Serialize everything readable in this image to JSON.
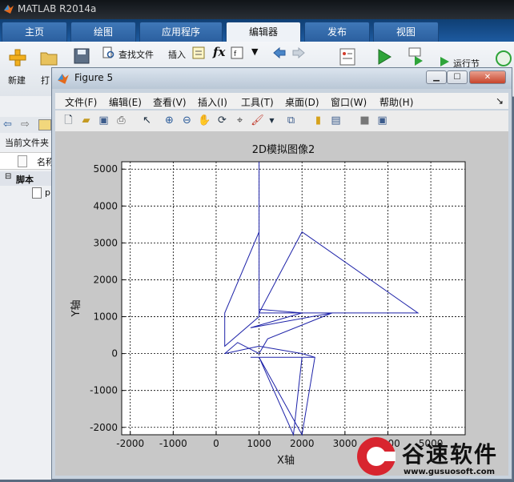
{
  "window": {
    "title": "MATLAB R2014a"
  },
  "tabs": [
    "主页",
    "绘图",
    "应用程序",
    "编辑器",
    "发布",
    "视图"
  ],
  "active_tab": "编辑器",
  "ribbon": {
    "new": "新建",
    "open_short": "打",
    "find_files": "查找文件",
    "insert": "插入",
    "fx": "fx",
    "run_advance": "运行节"
  },
  "left_panel": {
    "current_folder": "当前文件夹",
    "name_col": "名称",
    "script_group": "脚本",
    "file_initial": "p"
  },
  "figure": {
    "title": "Figure 5",
    "menu": [
      "文件(F)",
      "编辑(E)",
      "查看(V)",
      "插入(I)",
      "工具(T)",
      "桌面(D)",
      "窗口(W)",
      "帮助(H)"
    ]
  },
  "chart_data": {
    "type": "line",
    "title": "2D模拟图像2",
    "xlabel": "X轴",
    "ylabel": "Y轴",
    "xlim": [
      -2200,
      5800
    ],
    "ylim": [
      -2200,
      5200
    ],
    "xticks": [
      -2000,
      -1000,
      0,
      1000,
      2000,
      3000,
      4000,
      5000
    ],
    "xtick_labels": [
      "-2000",
      "-1000",
      "0",
      "1000",
      "2000",
      "3000",
      "4000",
      "5000"
    ],
    "yticks": [
      -2000,
      -1000,
      0,
      1000,
      2000,
      3000,
      4000,
      5000
    ],
    "ytick_labels": [
      "-2000",
      "-1000",
      "0",
      "1000",
      "2000",
      "3000",
      "4000",
      "5000"
    ],
    "grid": true,
    "line_color": "#1d22a8",
    "series": [
      {
        "x": [
          1000,
          1000,
          200,
          200,
          1000,
          1000,
          1000,
          1000,
          2000,
          4700,
          1000,
          1000,
          2000,
          800,
          2700,
          1200,
          1000,
          500,
          200,
          1000,
          2000,
          2300,
          2000,
          1000,
          1800,
          2000,
          1800,
          800,
          1500,
          2300,
          1000,
          1000
        ],
        "y": [
          5200,
          3300,
          1100,
          200,
          1000,
          1100,
          5200,
          1100,
          3300,
          1100,
          1100,
          1200,
          1100,
          700,
          1100,
          400,
          0,
          300,
          0,
          200,
          0,
          -100,
          -2200,
          -100,
          -2200,
          -100,
          -100,
          -100,
          -100,
          -100,
          -100,
          -100
        ]
      }
    ]
  },
  "watermark": {
    "brand": "谷速软件",
    "url": "www.gusuosoft.com"
  }
}
